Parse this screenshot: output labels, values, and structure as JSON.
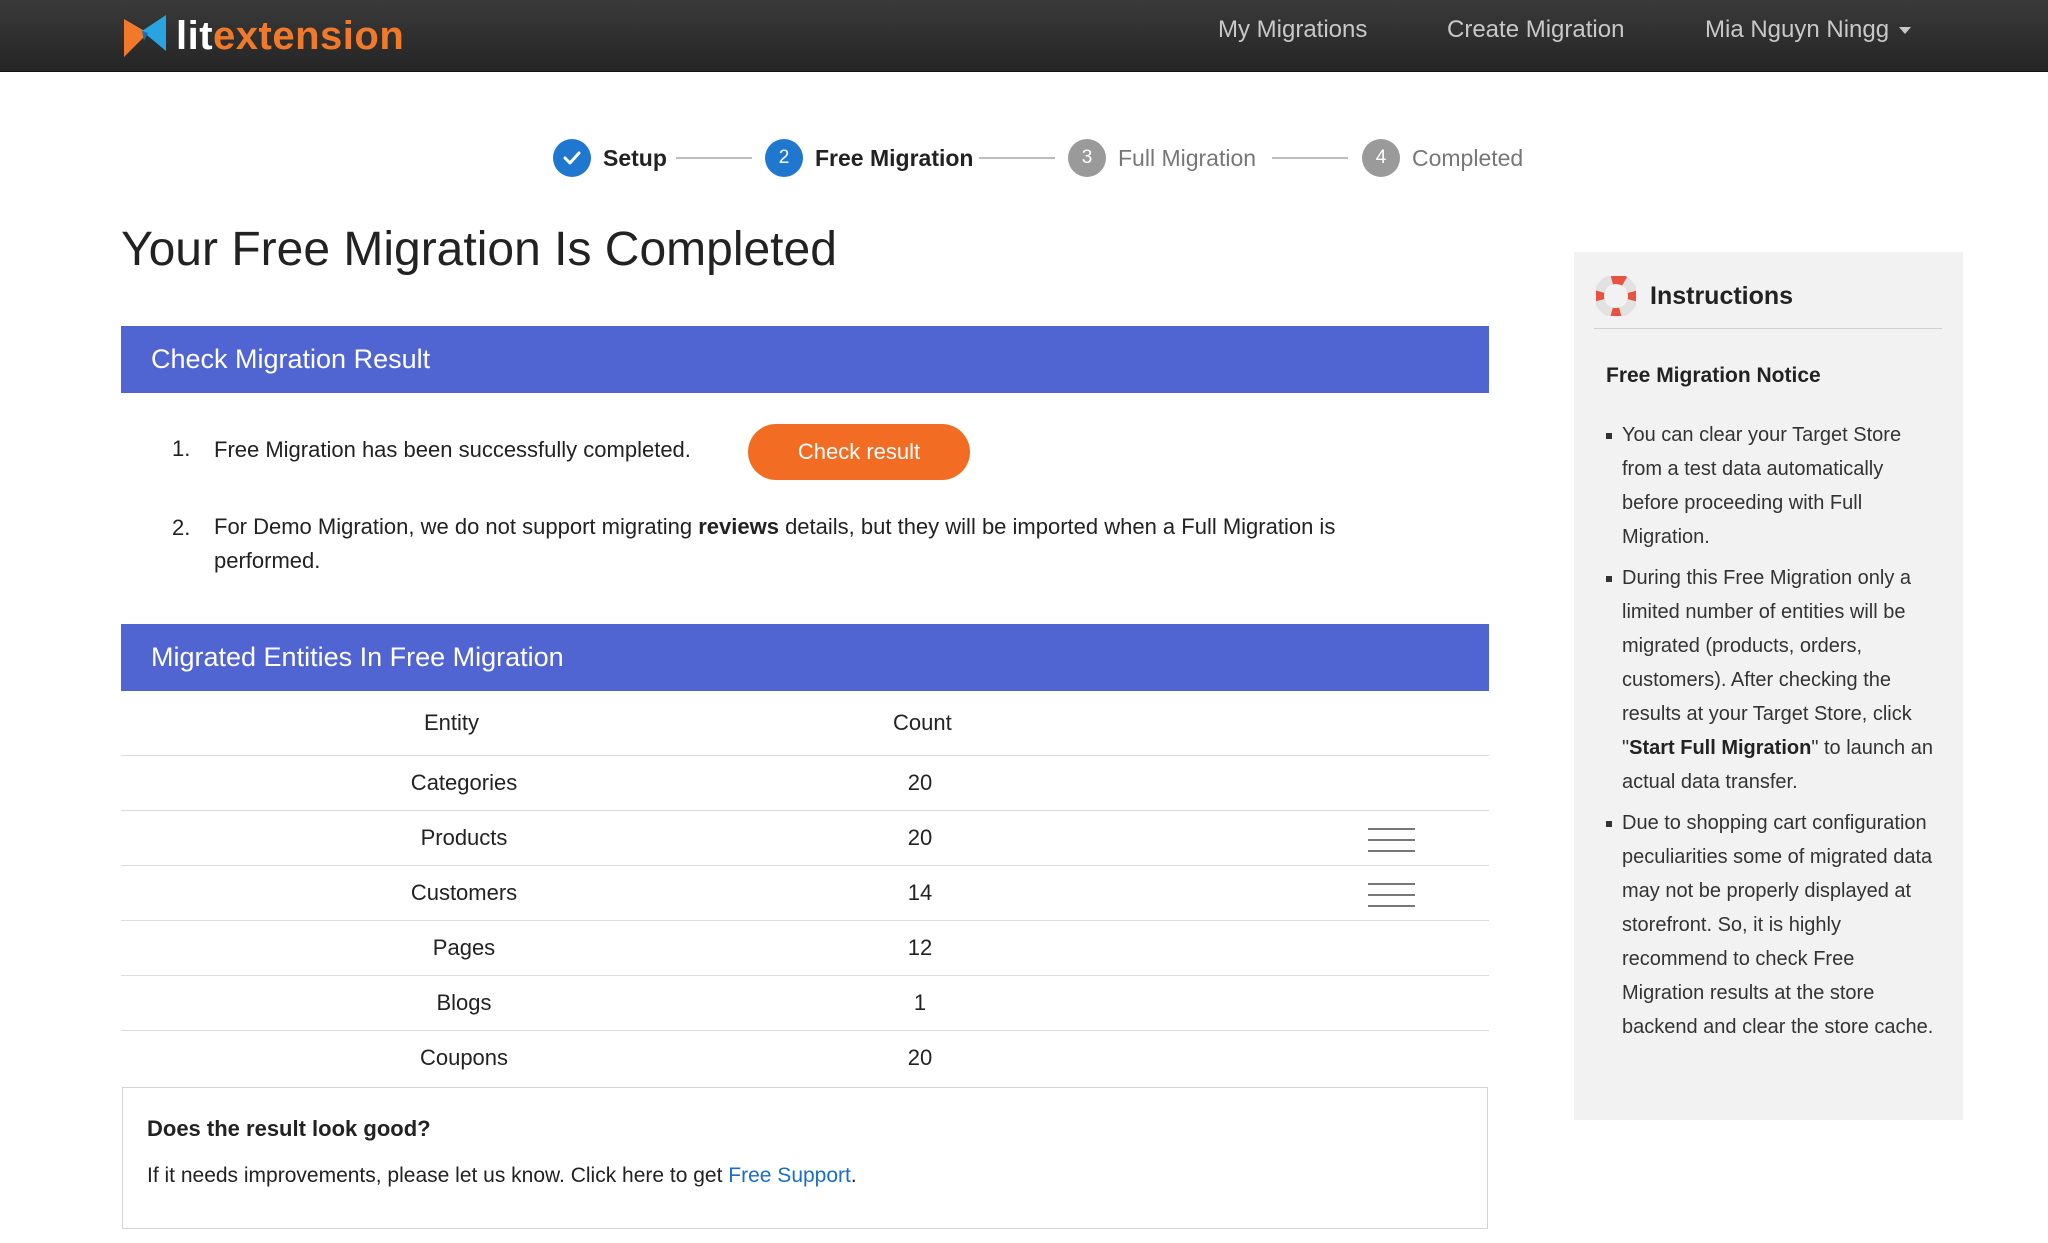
{
  "header": {
    "logo": {
      "part1": "lit",
      "part2": "extension"
    },
    "nav": [
      "My Migrations",
      "Create Migration"
    ],
    "user": "Mia Nguyn Ningg"
  },
  "stepper": {
    "steps": [
      {
        "number": "",
        "label": "Setup",
        "state": "done"
      },
      {
        "number": "2",
        "label": "Free Migration",
        "state": "active"
      },
      {
        "number": "3",
        "label": "Full Migration",
        "state": "inactive"
      },
      {
        "number": "4",
        "label": "Completed",
        "state": "inactive"
      }
    ]
  },
  "main": {
    "title": "Your Free Migration Is Completed",
    "result_section": {
      "header": "Check Migration Result",
      "items": [
        {
          "num": "1.",
          "text": "Free Migration has been successfully completed."
        },
        {
          "num": "2.",
          "before": "For Demo Migration, we do not support migrating ",
          "bold": "reviews",
          "after": " details, but they will be imported when a Full Migration is performed."
        }
      ],
      "check_button": "Check result"
    },
    "entities_section": {
      "header": "Migrated Entities In Free Migration",
      "columns": [
        "Entity",
        "Count"
      ],
      "rows": [
        {
          "entity": "Categories",
          "count": "20",
          "has_menu": false
        },
        {
          "entity": "Products",
          "count": "20",
          "has_menu": true
        },
        {
          "entity": "Customers",
          "count": "14",
          "has_menu": true
        },
        {
          "entity": "Pages",
          "count": "12",
          "has_menu": false
        },
        {
          "entity": "Blogs",
          "count": "1",
          "has_menu": false
        },
        {
          "entity": "Coupons",
          "count": "20",
          "has_menu": false
        }
      ]
    },
    "feedback": {
      "title": "Does the result look good?",
      "text": "If it needs improvements, please let us know. Click here to get ",
      "link": "Free Support",
      "end": "."
    }
  },
  "sidebar": {
    "title": "Instructions",
    "subtitle": "Free Migration Notice",
    "items": [
      {
        "text": "You can clear your Target Store from a test data automatically before proceeding with Full Migration."
      },
      {
        "before": "During this Free Migration only a limited number of entities will be migrated (products, orders, customers). After checking the results at your Target Store, click \"",
        "bold": "Start Full Migration",
        "after": "\" to launch an actual data transfer."
      },
      {
        "text": "Due to shopping cart configuration peculiarities some of migrated data may not be properly displayed at storefront. So, it is highly recommend to check Free Migration results at the store backend and clear the store cache."
      }
    ]
  },
  "colors": {
    "nav_bg": "#2e2e2e",
    "brand_orange": "#f07a2a",
    "step_active": "#1f77d0",
    "section_header": "#5064d2",
    "button_orange": "#f26c23",
    "link": "#1a6fc4"
  },
  "icons": {
    "logo": "litextension-logo-icon",
    "step_done": "checkmark-icon",
    "sidebar": "lifebuoy-icon",
    "row_menu": "hamburger-menu-icon"
  }
}
